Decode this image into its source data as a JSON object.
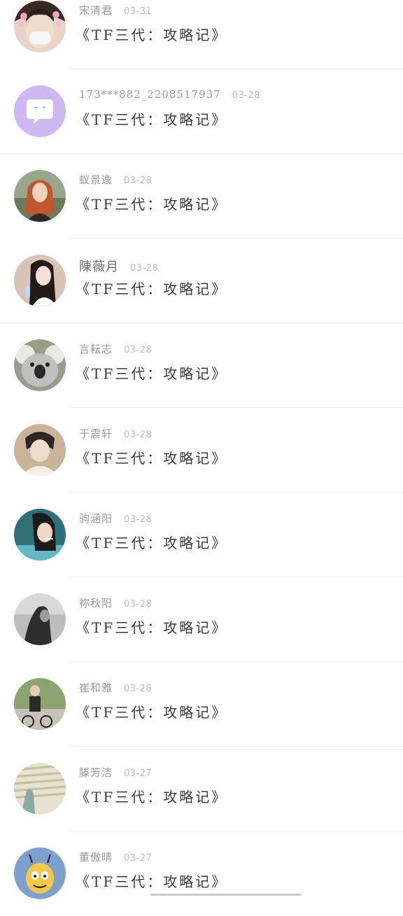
{
  "messages": [
    {
      "name": "宋清君",
      "date": "03-31",
      "text": "《TF三代：攻略记》",
      "avatar": "girl-mask-avatar"
    },
    {
      "name": "173***882_2208517937",
      "date": "03-28",
      "text": "《TF三代：攻略记》",
      "avatar": "default-chat-avatar"
    },
    {
      "name": "蚁景逸",
      "date": "03-28",
      "text": "《TF三代：攻略记》",
      "avatar": "red-hair-girl-avatar"
    },
    {
      "name": "陳薇月",
      "date": "03-28",
      "text": "《TF三代：攻略记》",
      "avatar": "girl-bottle-avatar"
    },
    {
      "name": "言耘志",
      "date": "03-28",
      "text": "《TF三代：攻略记》",
      "avatar": "koala-avatar"
    },
    {
      "name": "于震轩",
      "date": "03-28",
      "text": "《TF三代：攻略记》",
      "avatar": "boy-avatar"
    },
    {
      "name": "驹涵阳",
      "date": "03-28",
      "text": "《TF三代：攻略记》",
      "avatar": "girl-smoking-avatar"
    },
    {
      "name": "祢秋阳",
      "date": "03-28",
      "text": "《TF三代：攻略记》",
      "avatar": "bw-portrait-avatar"
    },
    {
      "name": "崔和雅",
      "date": "03-28",
      "text": "《TF三代：攻略记》",
      "avatar": "bike-girl-avatar"
    },
    {
      "name": "滕芳洁",
      "date": "03-27",
      "text": "《TF三代：攻略记》",
      "avatar": "window-light-avatar"
    },
    {
      "name": "董傲晴",
      "date": "03-27",
      "text": "《TF三代：攻略记》",
      "avatar": "cartoon-bee-avatar"
    }
  ]
}
